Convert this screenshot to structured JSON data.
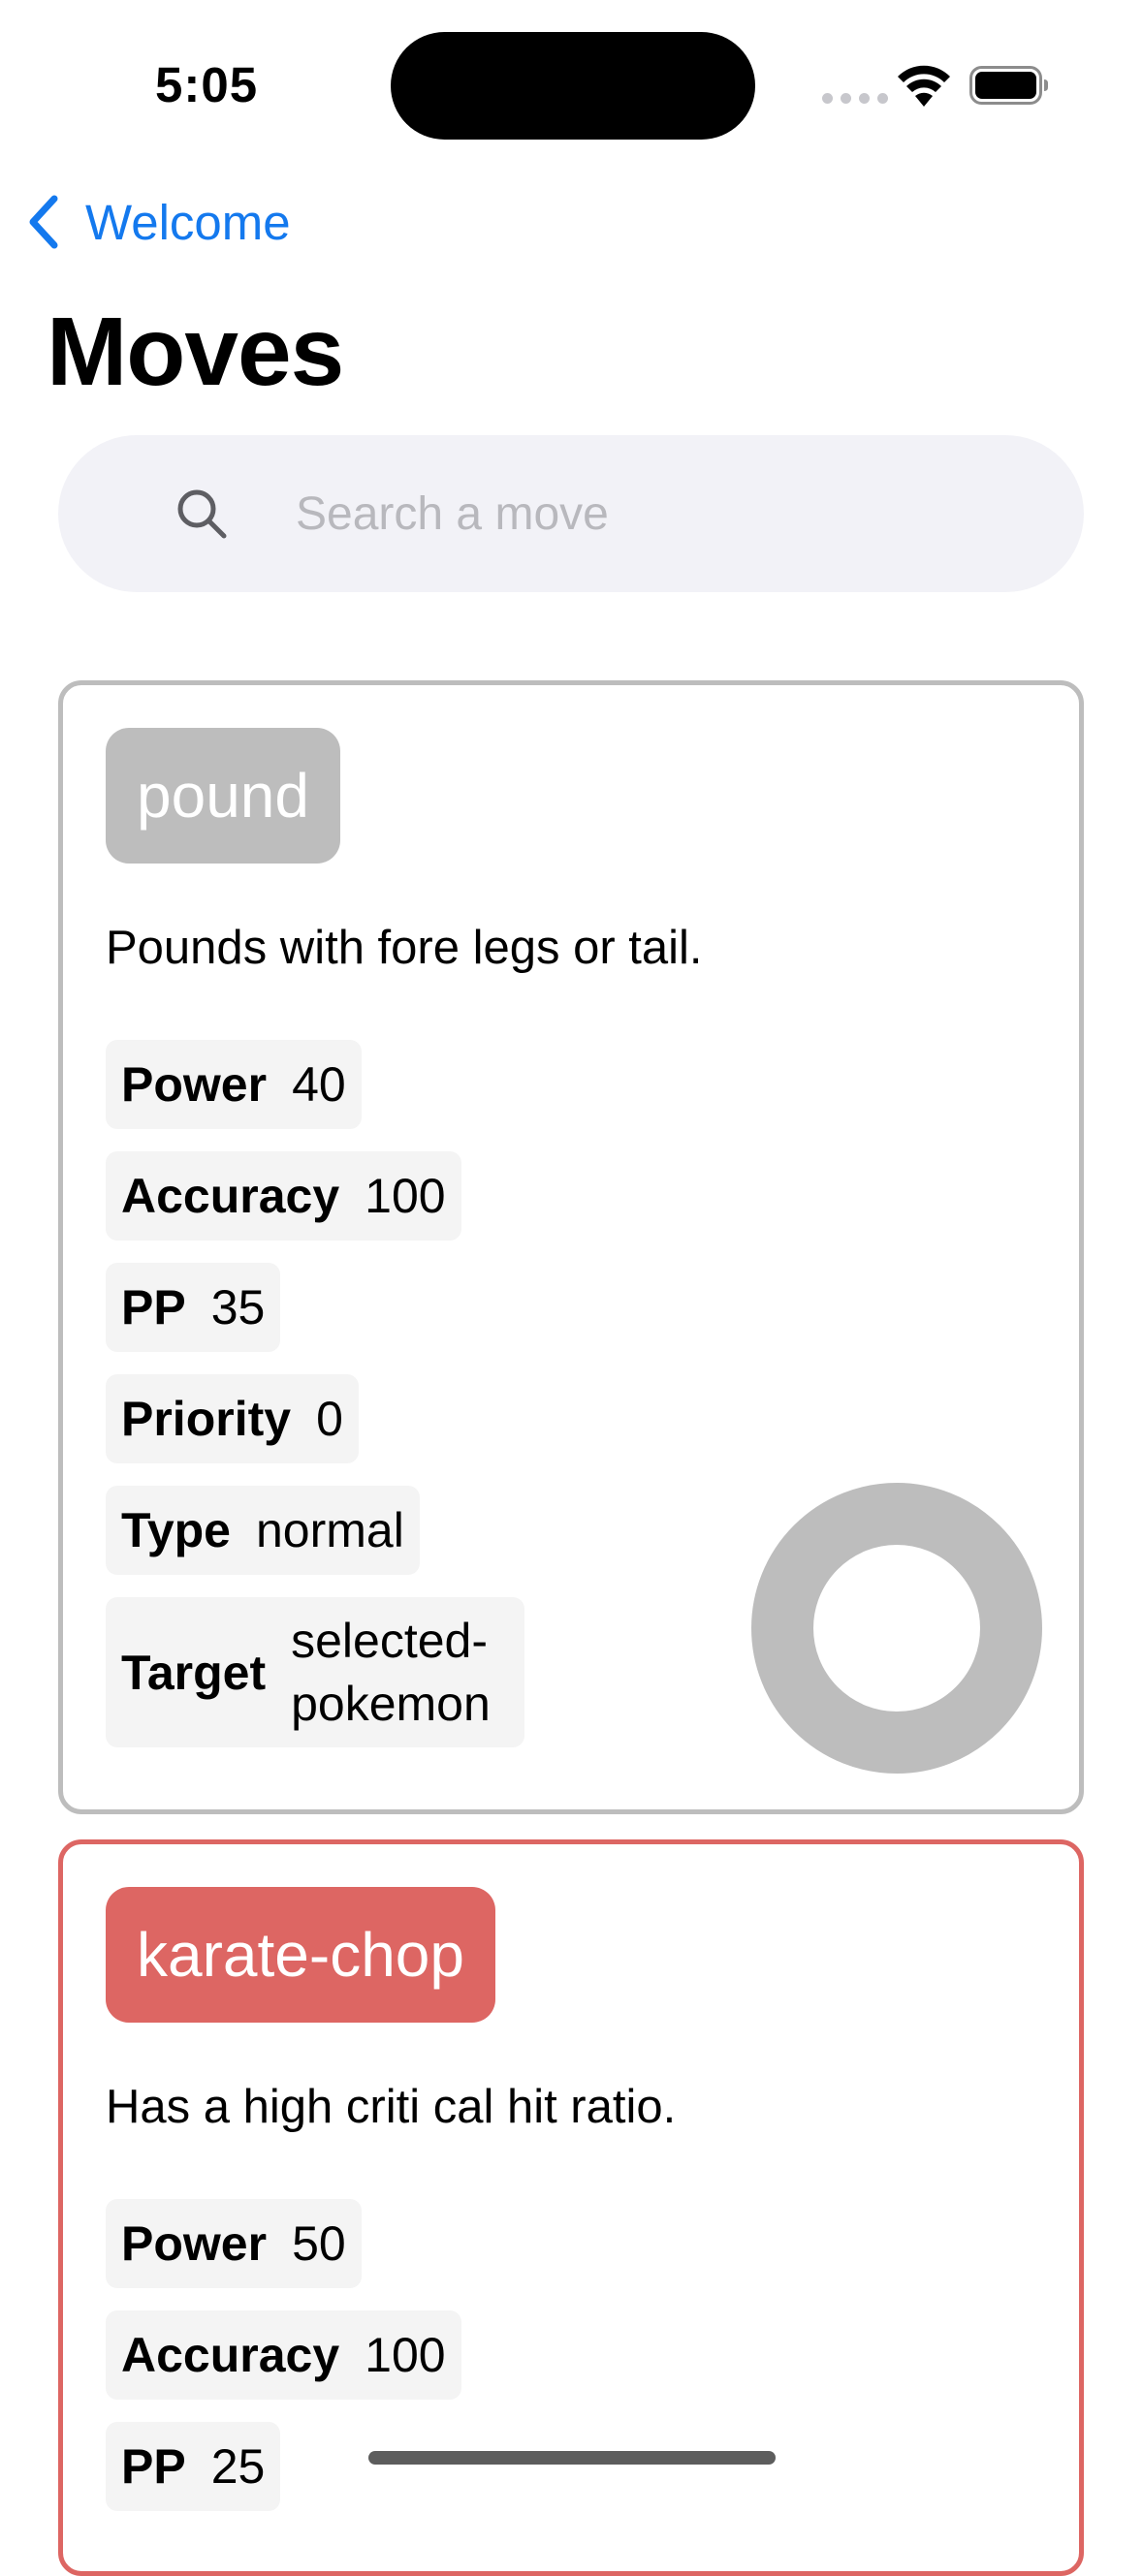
{
  "status_bar": {
    "time": "5:05"
  },
  "nav": {
    "back_label": "Welcome",
    "title": "Moves"
  },
  "search": {
    "placeholder": "Search a move",
    "value": ""
  },
  "colors": {
    "accent": "#1479ee",
    "normal_type": "#bdbdbd",
    "fighting_type": "#dd6663",
    "chip_background": "#f4f4f4",
    "search_background": "#f2f2f7"
  },
  "moves": [
    {
      "name": "pound",
      "description": "Pounds with fore legs or tail.",
      "type_color": "#bdbdbd",
      "type_icon": "normal-type-ring-icon",
      "stats": [
        {
          "label": "Power",
          "value": "40"
        },
        {
          "label": "Accuracy",
          "value": "100"
        },
        {
          "label": "PP",
          "value": "35"
        },
        {
          "label": "Priority",
          "value": "0"
        },
        {
          "label": "Type",
          "value": "normal"
        },
        {
          "label": "Target",
          "value": "selected-pokemon"
        }
      ]
    },
    {
      "name": "karate-chop",
      "description": "Has a high criti cal hit ratio.",
      "type_color": "#dd6663",
      "stats": [
        {
          "label": "Power",
          "value": "50"
        },
        {
          "label": "Accuracy",
          "value": "100"
        },
        {
          "label": "PP",
          "value": "25"
        }
      ]
    }
  ]
}
